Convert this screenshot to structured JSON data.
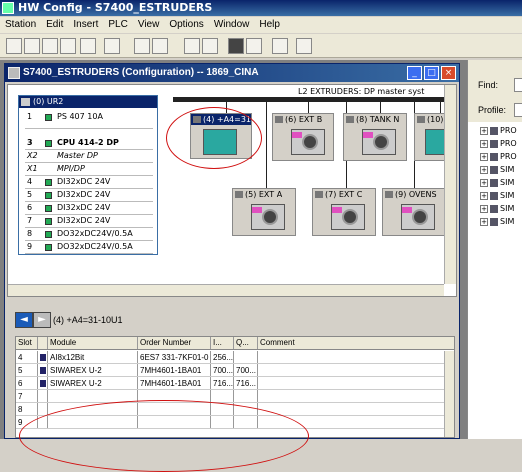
{
  "app": {
    "title": "HW Config - S7400_ESTRUDERS"
  },
  "menu": [
    "Station",
    "Edit",
    "Insert",
    "PLC",
    "View",
    "Options",
    "Window",
    "Help"
  ],
  "catalog": {
    "find_label": "Find:",
    "profile_label": "Profile:",
    "items": [
      "PRO",
      "PRO",
      "PRO",
      "SIM",
      "SIM",
      "SIM",
      "SIM",
      "SIM"
    ]
  },
  "child": {
    "title": "S7400_ESTRUDERS (Configuration) -- 1869_CINA"
  },
  "rack": {
    "title": "(0) UR2",
    "rows": [
      {
        "slot": "1",
        "module": "PS 407 10A"
      },
      {
        "slot": "3",
        "module": "CPU 414-2 DP"
      },
      {
        "slot": "X2",
        "module": "Master DP"
      },
      {
        "slot": "X1",
        "module": "MPI/DP"
      },
      {
        "slot": "4",
        "module": "DI32xDC 24V"
      },
      {
        "slot": "5",
        "module": "DI32xDC 24V"
      },
      {
        "slot": "6",
        "module": "DI32xDC 24V"
      },
      {
        "slot": "7",
        "module": "DI32xDC 24V"
      },
      {
        "slot": "8",
        "module": "DO32xDC24V/0.5A"
      },
      {
        "slot": "9",
        "module": "DO32xDC24V/0.5A"
      }
    ]
  },
  "network": {
    "label": "L2 EXTRUDERS: DP master syst",
    "stations": [
      {
        "label": "(4) +A4=31"
      },
      {
        "label": "(6) EXT B"
      },
      {
        "label": "(8) TANK N"
      },
      {
        "label": "(10)"
      },
      {
        "label": "(5) EXT A"
      },
      {
        "label": "(7) EXT C"
      },
      {
        "label": "(9) OVENS"
      }
    ]
  },
  "detail": {
    "title": "(4)   +A4=31-10U1",
    "columns": [
      "Slot",
      "",
      "Module",
      "Order Number",
      "I...",
      "Q...",
      "Comment"
    ],
    "rows": [
      {
        "slot": "4",
        "module": "AI8x12Bit",
        "order": "6ES7 331-7KF01-0",
        "i": "256...",
        "q": "",
        "comment": ""
      },
      {
        "slot": "5",
        "module": "SIWAREX U-2",
        "order": "7MH4601-1BA01",
        "i": "700...",
        "q": "700...",
        "comment": ""
      },
      {
        "slot": "6",
        "module": "SIWAREX U-2",
        "order": "7MH4601-1BA01",
        "i": "716...",
        "q": "716...",
        "comment": ""
      },
      {
        "slot": "7",
        "module": "",
        "order": "",
        "i": "",
        "q": "",
        "comment": ""
      },
      {
        "slot": "8",
        "module": "",
        "order": "",
        "i": "",
        "q": "",
        "comment": ""
      },
      {
        "slot": "9",
        "module": "",
        "order": "",
        "i": "",
        "q": "",
        "comment": ""
      }
    ]
  }
}
